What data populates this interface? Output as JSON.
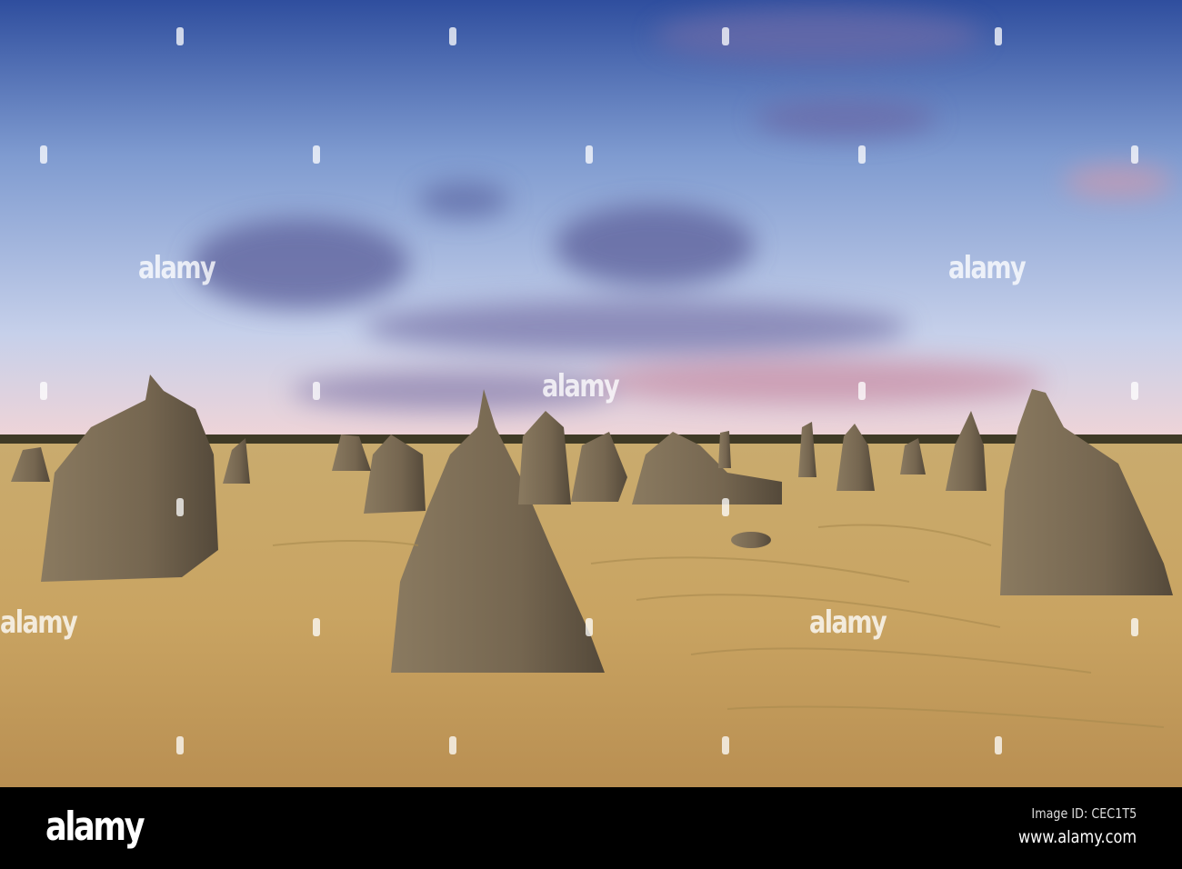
{
  "image": {
    "subject": "Pinnacles desert rock formations under a twilight sky with streaked clouds"
  },
  "watermark": {
    "text": "alamy"
  },
  "footer": {
    "logo": "alamy",
    "image_id": "Image ID: CEC1T5",
    "website": "www.alamy.com"
  },
  "colors": {
    "sky_top": "#3a5aa8",
    "sky_horizon": "#f1d6d8",
    "sand": "#c9a664",
    "rock": "#7a6a52",
    "footer": "#000000"
  }
}
